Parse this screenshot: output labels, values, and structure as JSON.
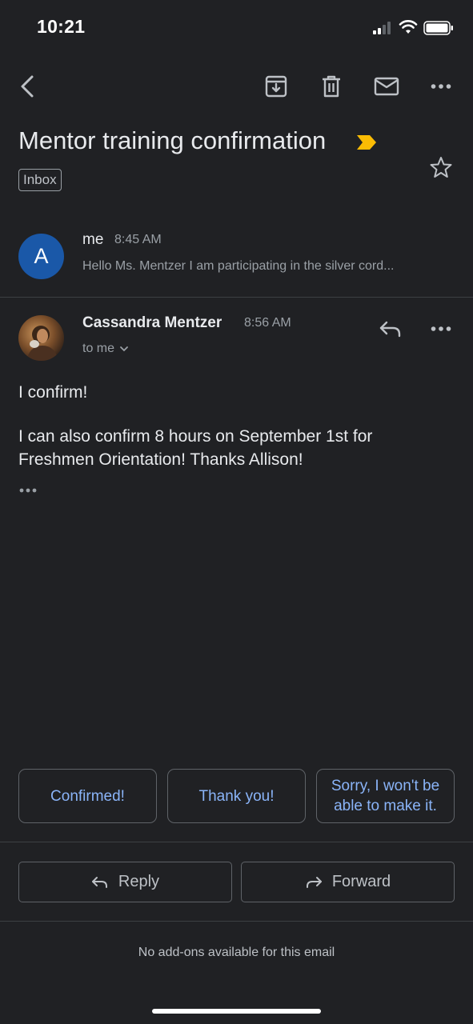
{
  "status_bar": {
    "time": "10:21",
    "icons": [
      "signal-icon",
      "wifi-icon",
      "battery-icon"
    ]
  },
  "toolbar": {
    "icons": [
      "back-icon",
      "archive-icon",
      "trash-icon",
      "mark-unread-icon",
      "more-icon"
    ]
  },
  "thread": {
    "subject": "Mentor training confirmation",
    "label": "Inbox",
    "importance_color": "#fbbc04"
  },
  "messages": [
    {
      "avatar_letter": "A",
      "avatar_color": "#1a58a8",
      "sender": "me",
      "time": "8:45 AM",
      "snippet": "Hello Ms. Mentzer I am participating in the silver cord..."
    },
    {
      "sender": "Cassandra Mentzer",
      "time": "8:56 AM",
      "recipient": "to me",
      "body": [
        "I confirm!",
        "I can also confirm 8 hours on September 1st for Freshmen Orientation! Thanks Allison!"
      ]
    }
  ],
  "smart_replies": [
    "Confirmed!",
    "Thank you!",
    "Sorry, I won't be able to make it."
  ],
  "actions": {
    "reply": "Reply",
    "forward": "Forward"
  },
  "footer": {
    "addons_text": "No add-ons available for this email"
  },
  "colors": {
    "background": "#202124",
    "accent": "#8ab4f8"
  }
}
